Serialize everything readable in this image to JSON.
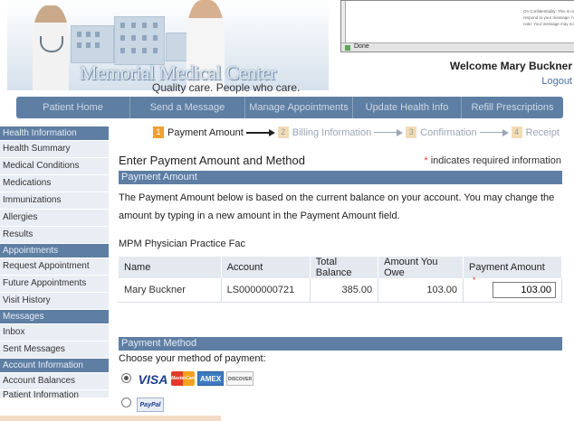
{
  "header": {
    "brand": "Memorial Medical Center",
    "tagline": "Quality care. People who care.",
    "welcome": "Welcome Mary Buckner",
    "logout": "Logout"
  },
  "browser_popup": {
    "confidentiality_text": "On Confidentiality: This is not respond to your message; how note: Your message may not",
    "status": "Done"
  },
  "topnav": [
    {
      "label": "Patient Home"
    },
    {
      "label": "Send a Message"
    },
    {
      "label": "Manage Appointments"
    },
    {
      "label": "Update Health Info"
    },
    {
      "label": "Refill Prescriptions"
    }
  ],
  "sidebar": {
    "health_information": {
      "heading": "Health Information",
      "items": [
        "Health Summary",
        "Medical Conditions",
        "Medications",
        "Immunizations",
        "Allergies",
        "Results"
      ]
    },
    "appointments": {
      "heading": "Appointments",
      "items": [
        "Request Appointment",
        "Future Appointments",
        "Visit History"
      ]
    },
    "messages": {
      "heading": "Messages",
      "items": [
        "Inbox",
        "Sent Messages"
      ]
    },
    "account_information": {
      "heading": "Account Information",
      "items": [
        "Account Balances",
        "Patient Information"
      ]
    }
  },
  "steps": [
    {
      "number": "1",
      "label": "Payment Amount"
    },
    {
      "number": "2",
      "label": "Billing Information"
    },
    {
      "number": "3",
      "label": "Confirmation"
    },
    {
      "number": "4",
      "label": "Receipt"
    }
  ],
  "page": {
    "title": "Enter Payment Amount and Method",
    "required_star": "*",
    "required_note": "indicates required information",
    "payment_amount_heading": "Payment Amount",
    "description": "The Payment Amount below is based on the current balance on your account. You may change the amount by typing in a new amount in the Payment Amount field.",
    "practice": "MPM Physician Practice Fac",
    "payment_method_heading": "Payment Method",
    "choose_method": "Choose your method of payment:"
  },
  "table": {
    "columns": [
      "Name",
      "Account",
      "Total Balance",
      "Amount You Owe",
      "Payment Amount"
    ],
    "row": {
      "name": "Mary Buckner",
      "account": "LS0000000721",
      "total_balance": "385.00",
      "amount_owed": "103.00",
      "payment_amount": "103.00",
      "required_star": "*"
    }
  },
  "payment_methods": {
    "visa": "VISA",
    "mastercard": "MasterCard",
    "amex": "AMEX",
    "discover": "DISCOVER",
    "paypal": "PayPal",
    "selected": "credit-card"
  },
  "colors": {
    "nav_blue": "#5e7ea3",
    "sidebar_item_bg": "#e9eef4",
    "step_active": "#f0a030",
    "required_red": "#e04040"
  }
}
